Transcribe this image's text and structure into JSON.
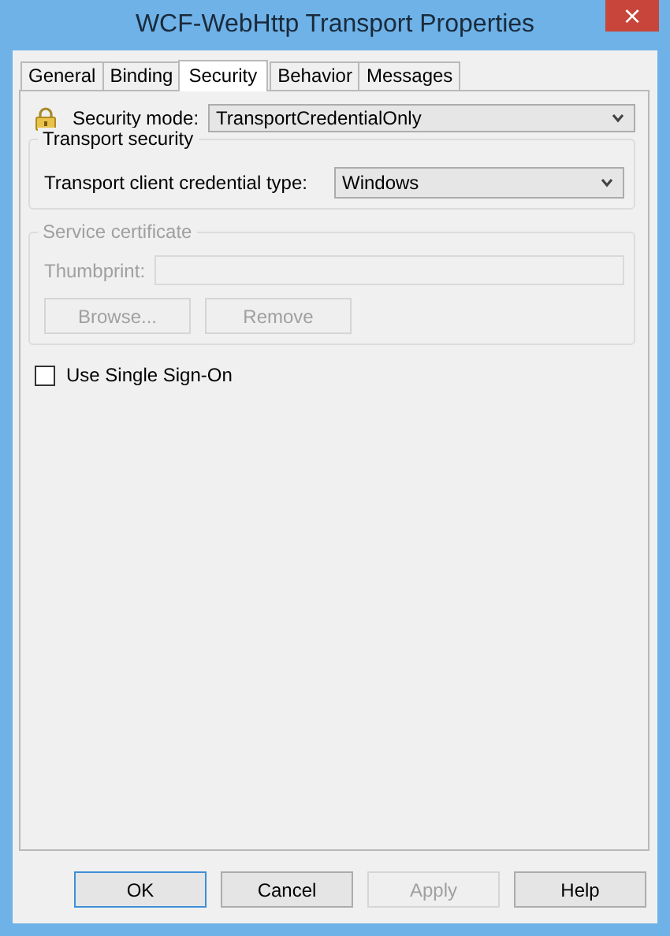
{
  "window": {
    "title": "WCF-WebHttp Transport Properties",
    "close": "×"
  },
  "tabs": [
    {
      "label": "General",
      "selected": false
    },
    {
      "label": "Binding",
      "selected": false
    },
    {
      "label": "Security",
      "selected": true
    },
    {
      "label": "Behavior",
      "selected": false
    },
    {
      "label": "Messages",
      "selected": false
    }
  ],
  "security_mode": {
    "label": "Security mode:",
    "value": "TransportCredentialOnly"
  },
  "transport_security": {
    "title": "Transport security",
    "disabled": false,
    "label": "Transport client credential type:",
    "value": "Windows"
  },
  "service_certificate": {
    "title": "Service certificate",
    "disabled": true,
    "label": "Thumbprint:",
    "buttons": [
      {
        "label": "Browse..."
      },
      {
        "label": "Remove"
      }
    ]
  },
  "single_sign_on": {
    "label": "Use Single Sign-On",
    "checked": false
  },
  "buttons": [
    {
      "label": "OK",
      "disabled": false,
      "default": true
    },
    {
      "label": "Cancel",
      "disabled": false,
      "default": false
    },
    {
      "label": "Apply",
      "disabled": true,
      "default": false
    },
    {
      "label": "Help",
      "disabled": false,
      "default": false
    }
  ]
}
